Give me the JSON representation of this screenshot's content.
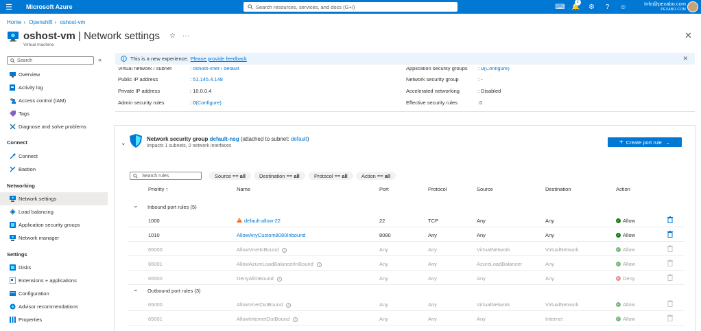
{
  "topbar": {
    "brand": "Microsoft Azure",
    "search_placeholder": "Search resources, services, and docs (G+/)",
    "notification_count": "1",
    "account_email": "Info@pexabo.com",
    "account_org": "PEXABO.COM"
  },
  "breadcrumb": [
    "Home",
    "Openshift",
    "oshost-vm"
  ],
  "page": {
    "resource": "oshost-vm",
    "title_rest": " | Network settings",
    "subtitle": "Virtual machine"
  },
  "sidebar": {
    "search_placeholder": "Search",
    "items": [
      {
        "label": "Overview"
      },
      {
        "label": "Activity log"
      },
      {
        "label": "Access control (IAM)"
      },
      {
        "label": "Tags"
      },
      {
        "label": "Diagnose and solve problems"
      }
    ],
    "connect_header": "Connect",
    "connect_items": [
      {
        "label": "Connect"
      },
      {
        "label": "Bastion"
      }
    ],
    "networking_header": "Networking",
    "networking_items": [
      {
        "label": "Network settings"
      },
      {
        "label": "Load balancing"
      },
      {
        "label": "Application security groups"
      },
      {
        "label": "Network manager"
      }
    ],
    "settings_header": "Settings",
    "settings_items": [
      {
        "label": "Disks"
      },
      {
        "label": "Extensions + applications"
      },
      {
        "label": "Configuration"
      },
      {
        "label": "Advisor recommendations"
      },
      {
        "label": "Properties"
      }
    ]
  },
  "banner": {
    "text": "This is a new experience.",
    "link": "Please provide feedback"
  },
  "props": {
    "vnet_label": "Virtual network / subnet",
    "vnet_value": ": oshost-vnet / default",
    "pip_label": "Public IP address",
    "pip_value": ": 51.145.4.148",
    "privip_label": "Private IP address",
    "privip_value": ": 10.0.0.4",
    "admin_label": "Admin security rules",
    "admin_value_prefix": ": 0 ",
    "admin_value_link": "(Configure)",
    "asg_label": "Application security groups",
    "asg_value_prefix": ": 0 ",
    "asg_value_link": "(Configure)",
    "nsg_label": "Network security group",
    "nsg_value": ": -",
    "accel_label": "Accelerated networking",
    "accel_value": ": Disabled",
    "eff_label": "Effective security rules",
    "eff_value_prefix": ": ",
    "eff_value_link": "0"
  },
  "nsg": {
    "prefix": "Network security group",
    "name": "default-nsg",
    "attached_prefix": "(attached to subnet:",
    "attached_link": "default",
    "attached_suffix": ")",
    "impacts": "Impacts 1 subnets, 0 network interfaces",
    "create_label": "Create port rule"
  },
  "filters": {
    "search_placeholder": "Search rules",
    "pills": [
      {
        "key": "Source ==",
        "val": "all"
      },
      {
        "key": "Destination ==",
        "val": "all"
      },
      {
        "key": "Protocol ==",
        "val": "all"
      },
      {
        "key": "Action ==",
        "val": "all"
      }
    ]
  },
  "columns": [
    "Priority ↑",
    "Name",
    "Port",
    "Protocol",
    "Source",
    "Destination",
    "Action"
  ],
  "inbound_title": "Inbound port rules (5)",
  "inbound": [
    {
      "priority": "1000",
      "name": "default-allow-22",
      "port": "22",
      "protocol": "TCP",
      "source": "Any",
      "destination": "Any",
      "action": "Allow",
      "warn": true,
      "custom": true
    },
    {
      "priority": "1010",
      "name": "AllowAnyCustom8080Inbound",
      "port": "8080",
      "protocol": "Any",
      "source": "Any",
      "destination": "Any",
      "action": "Allow",
      "warn": false,
      "custom": true
    },
    {
      "priority": "65000",
      "name": "AllowVnetInBound",
      "port": "Any",
      "protocol": "Any",
      "source": "VirtualNetwork",
      "destination": "VirtualNetwork",
      "action": "Allow",
      "warn": false,
      "custom": false
    },
    {
      "priority": "65001",
      "name": "AllowAzureLoadBalancerInBound",
      "port": "Any",
      "protocol": "Any",
      "source": "AzureLoadBalancer",
      "destination": "Any",
      "action": "Allow",
      "warn": false,
      "custom": false
    },
    {
      "priority": "65500",
      "name": "DenyAllInBound",
      "port": "Any",
      "protocol": "Any",
      "source": "Any",
      "destination": "Any",
      "action": "Deny",
      "warn": false,
      "custom": false
    }
  ],
  "outbound_title": "Outbound port rules (3)",
  "outbound": [
    {
      "priority": "65000",
      "name": "AllowVnetOutBound",
      "port": "Any",
      "protocol": "Any",
      "source": "VirtualNetwork",
      "destination": "VirtualNetwork",
      "action": "Allow",
      "warn": false,
      "custom": false
    },
    {
      "priority": "65001",
      "name": "AllowInternetOutBound",
      "port": "Any",
      "protocol": "Any",
      "source": "Any",
      "destination": "Internet",
      "action": "Allow",
      "warn": false,
      "custom": false
    }
  ],
  "colors": {
    "accent": "#0078d4",
    "allow": "#107c10",
    "deny": "#d13438",
    "warn": "#f7630c"
  }
}
